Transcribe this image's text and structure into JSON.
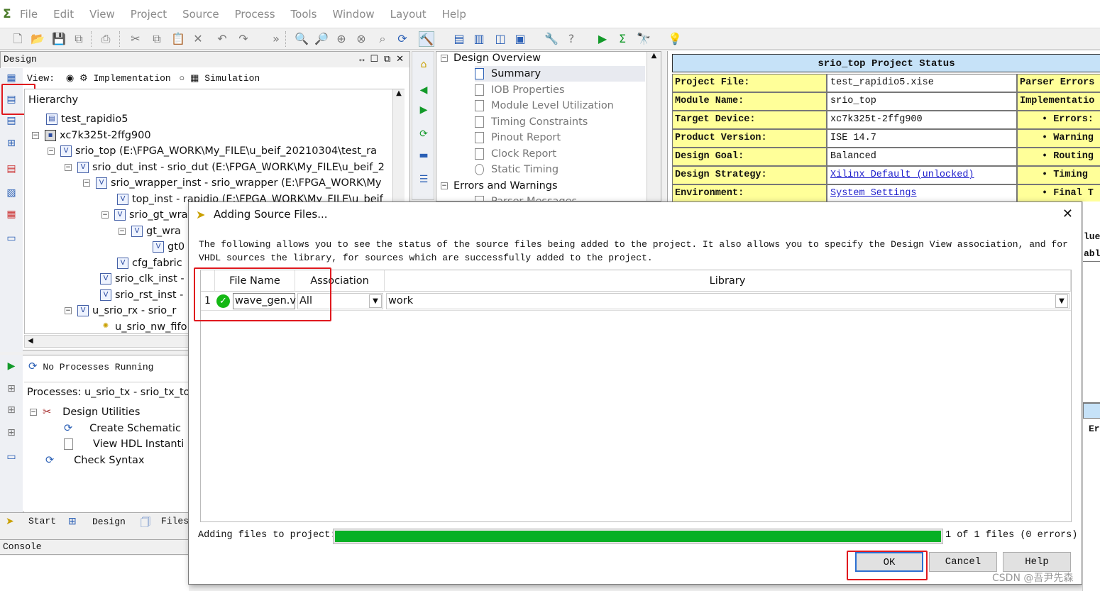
{
  "menu": {
    "items": [
      "File",
      "Edit",
      "View",
      "Project",
      "Source",
      "Process",
      "Tools",
      "Window",
      "Layout",
      "Help"
    ]
  },
  "design_panel": {
    "title": "Design",
    "view_label": "View:",
    "impl_label": "Implementation",
    "sim_label": "Simulation",
    "hierarchy_label": "Hierarchy",
    "tree": [
      "test_rapidio5",
      "xc7k325t-2ffg900",
      "srio_top (E:\\FPGA_WORK\\My_FILE\\u_beif_20210304\\test_ra",
      "srio_dut_inst - srio_dut (E:\\FPGA_WORK\\My_FILE\\u_beif_2",
      "srio_wrapper_inst - srio_wrapper (E:\\FPGA_WORK\\My",
      "top_inst - rapidio (E:\\FPGA_WORK\\My_FILE\\u_beif",
      "srio_gt_wra",
      "gt_wra",
      "gt0",
      "cfg_fabric",
      "srio_clk_inst -",
      "srio_rst_inst -",
      "u_srio_rx - srio_r",
      "u_srio_nw_fifo"
    ]
  },
  "process_panel": {
    "status": "No Processes Running",
    "title": "Processes: u_srio_tx - srio_tx_to",
    "items": [
      "Design Utilities",
      "Create Schematic",
      "View HDL Instanti",
      "Check Syntax"
    ]
  },
  "bottom_tabs": [
    "Start",
    "Design",
    "Files"
  ],
  "console_label": "Console",
  "overview": {
    "root": "Design Overview",
    "items": [
      "Summary",
      "IOB Properties",
      "Module Level Utilization",
      "Timing Constraints",
      "Pinout Report",
      "Clock Report",
      "Static Timing"
    ],
    "errors": "Errors and Warnings",
    "errors_child": "Parser Messages"
  },
  "project_status": {
    "header": "srio_top Project Status",
    "rows": [
      {
        "key": "Project File:",
        "value": "test_rapidio5.xise",
        "right": "Parser Errors"
      },
      {
        "key": "Module Name:",
        "value": "srio_top",
        "right": "Implementatio"
      },
      {
        "key": "Target Device:",
        "value": "xc7k325t-2ffg900",
        "right": "• Errors:"
      },
      {
        "key": "Product Version:",
        "value": "ISE 14.7",
        "right": "• Warning"
      },
      {
        "key": "Design Goal:",
        "value": "Balanced",
        "right": "• Routing"
      },
      {
        "key": "Design Strategy:",
        "value": "Xilinx Default (unlocked)",
        "right": "• Timing"
      },
      {
        "key": "Environment:",
        "value": "System Settings",
        "right": "• Final T"
      }
    ],
    "side_fragments": [
      "lue",
      "able",
      "Er"
    ]
  },
  "dialog": {
    "title": "Adding Source Files...",
    "description": "The following allows you to see the status of the source files being added to the project.  It also allows you to specify the Design View association, and for VHDL sources the library, for sources which are successfully added to the project.",
    "columns": [
      "File Name",
      "Association",
      "Library"
    ],
    "rows": [
      {
        "index": "1",
        "file": "wave_gen.v",
        "association": "All",
        "library": "work"
      }
    ],
    "progress_label": "Adding files to project:",
    "progress_value": 1.0,
    "progress_text": "1 of 1 files (0 errors)",
    "buttons": {
      "ok": "OK",
      "cancel": "Cancel",
      "help": "Help"
    }
  },
  "watermark": "CSDN @吾尹先森",
  "colors": {
    "accent_green": "#14b814",
    "highlight_red": "#e0191e",
    "status_header": "#c6e2f8",
    "status_key": "#ffff99"
  }
}
